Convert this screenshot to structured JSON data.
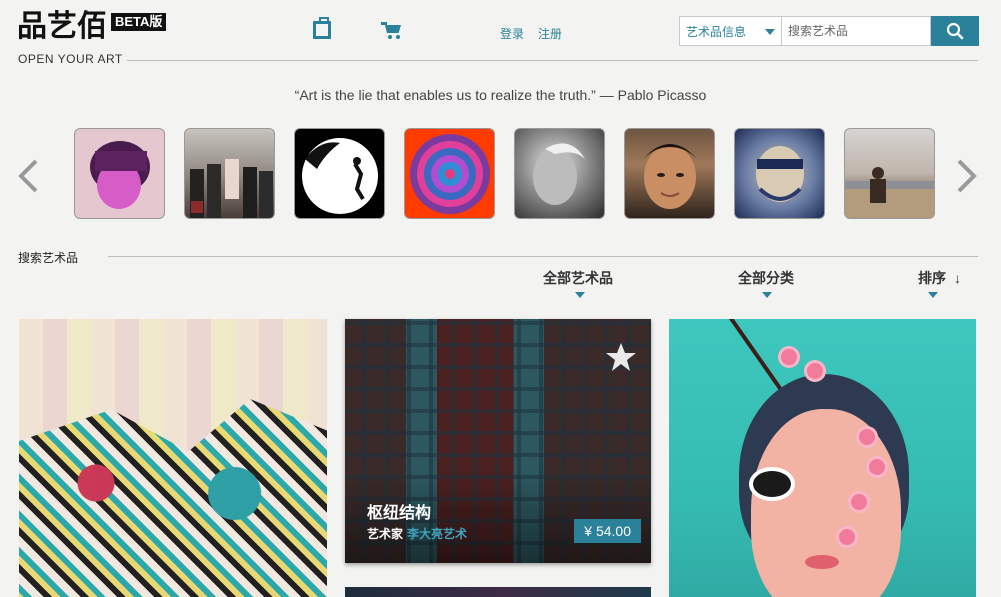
{
  "header": {
    "logo_text": "品艺佰",
    "beta_label": "BETA版",
    "tagline": "OPEN YOUR ART",
    "nav": {
      "login": "登录",
      "register": "注册"
    },
    "search": {
      "category_selected": "艺术品信息",
      "placeholder": "搜索艺术品"
    }
  },
  "quote": "“Art is the lie that enables us to realize the truth.” — Pablo Picasso",
  "section": {
    "title": "搜索艺术品",
    "filters": [
      {
        "label": "全部艺术品"
      },
      {
        "label": "全部分类"
      },
      {
        "label": "排序"
      }
    ]
  },
  "cards": [
    {},
    {
      "title": "枢纽结构",
      "artist_label": "艺术家",
      "artist_name": "李大亮艺术",
      "price": "¥ 54.00"
    },
    {}
  ],
  "colors": {
    "accent": "#2a8199",
    "background": "#f3f3f1"
  }
}
